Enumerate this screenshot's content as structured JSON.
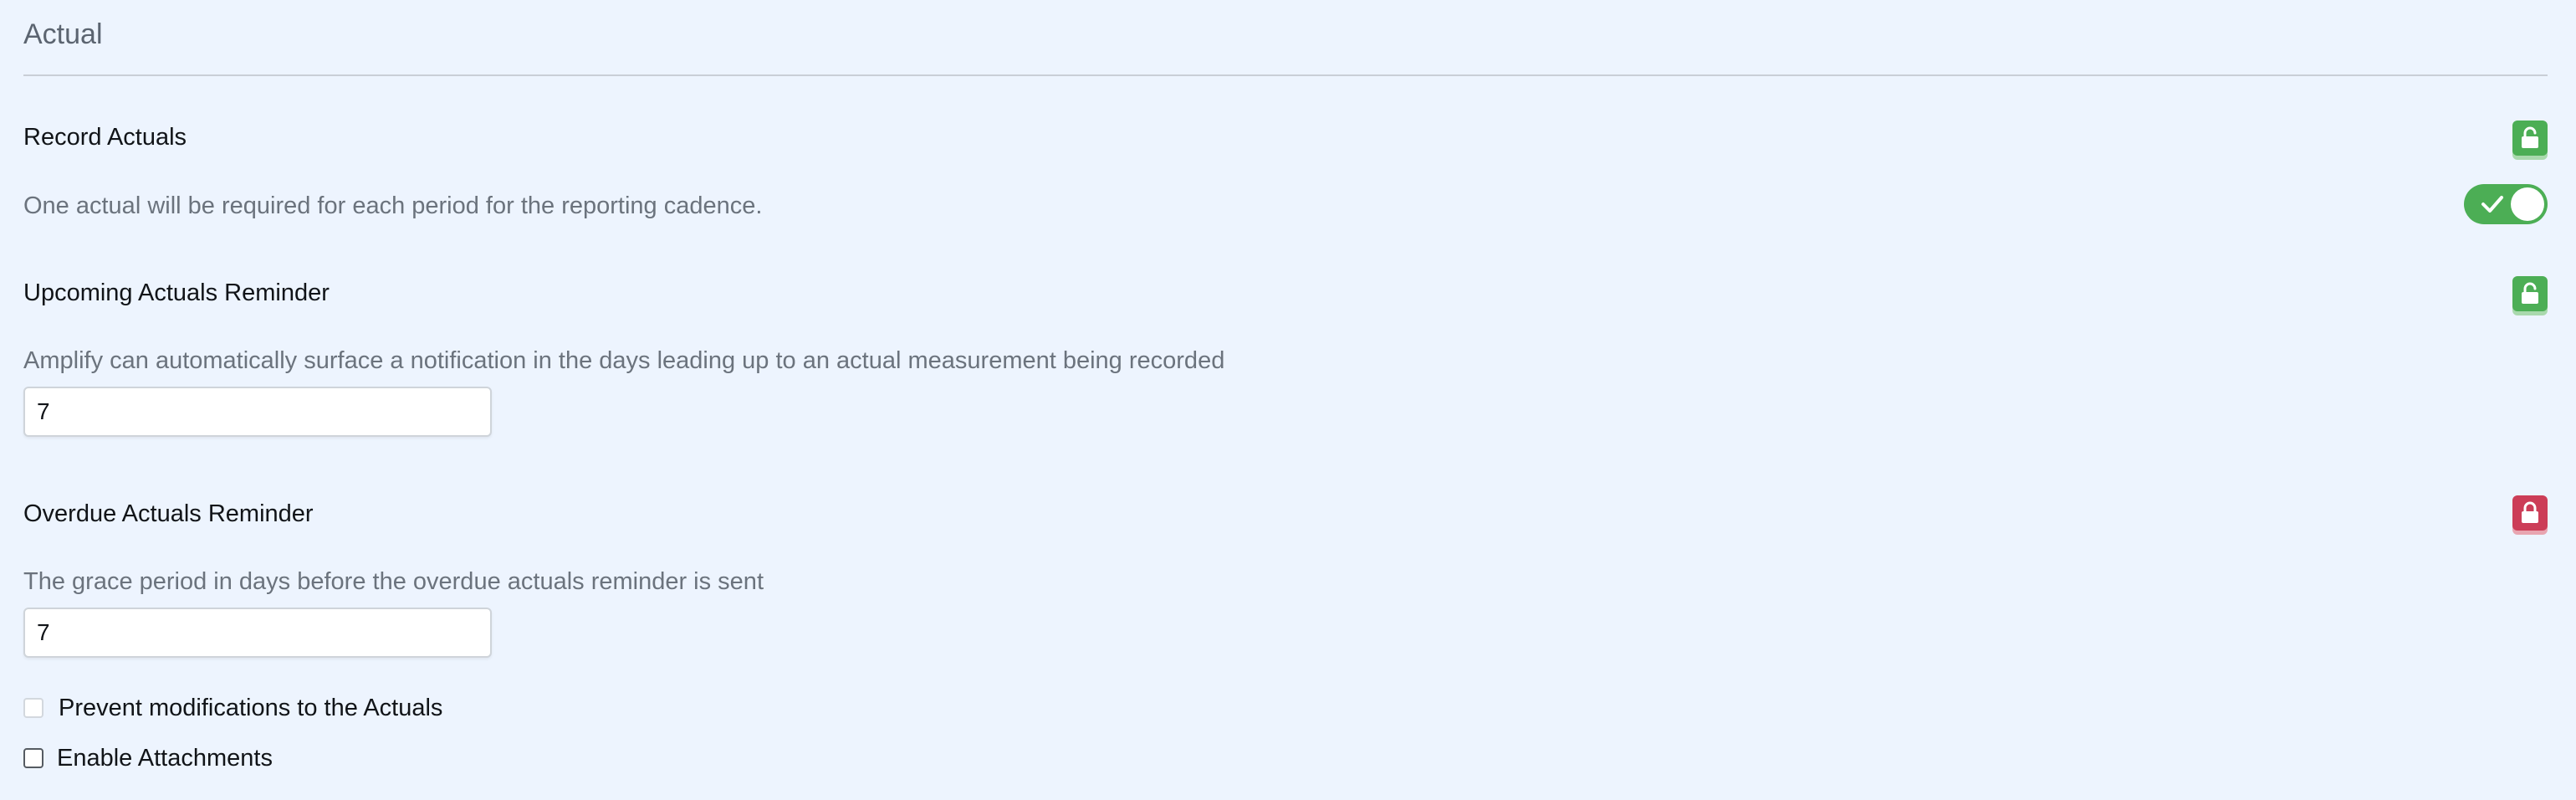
{
  "section": {
    "title": "Actual"
  },
  "record_actuals": {
    "heading": "Record Actuals",
    "description": "One actual will be required for each period for the reporting cadence.",
    "lock_state": "unlocked",
    "lock_icon": "unlocked-padlock-icon",
    "lock_color": "#4cae55",
    "toggle_on": true,
    "toggle_color": "#4cae55"
  },
  "upcoming_reminder": {
    "heading": "Upcoming Actuals Reminder",
    "description": "Amplify can automatically surface a notification in the days leading up to an actual measurement being recorded",
    "value": "7",
    "lock_state": "unlocked",
    "lock_icon": "unlocked-padlock-icon",
    "lock_color": "#4cae55"
  },
  "overdue_reminder": {
    "heading": "Overdue Actuals Reminder",
    "description": "The grace period in days before the overdue actuals reminder is sent",
    "value": "7",
    "lock_state": "locked",
    "lock_icon": "locked-padlock-icon",
    "lock_color": "#cc3d57"
  },
  "options": [
    {
      "label": "Prevent modifications to the Actuals",
      "checked": false
    },
    {
      "label": "Enable Attachments",
      "checked": false
    }
  ]
}
